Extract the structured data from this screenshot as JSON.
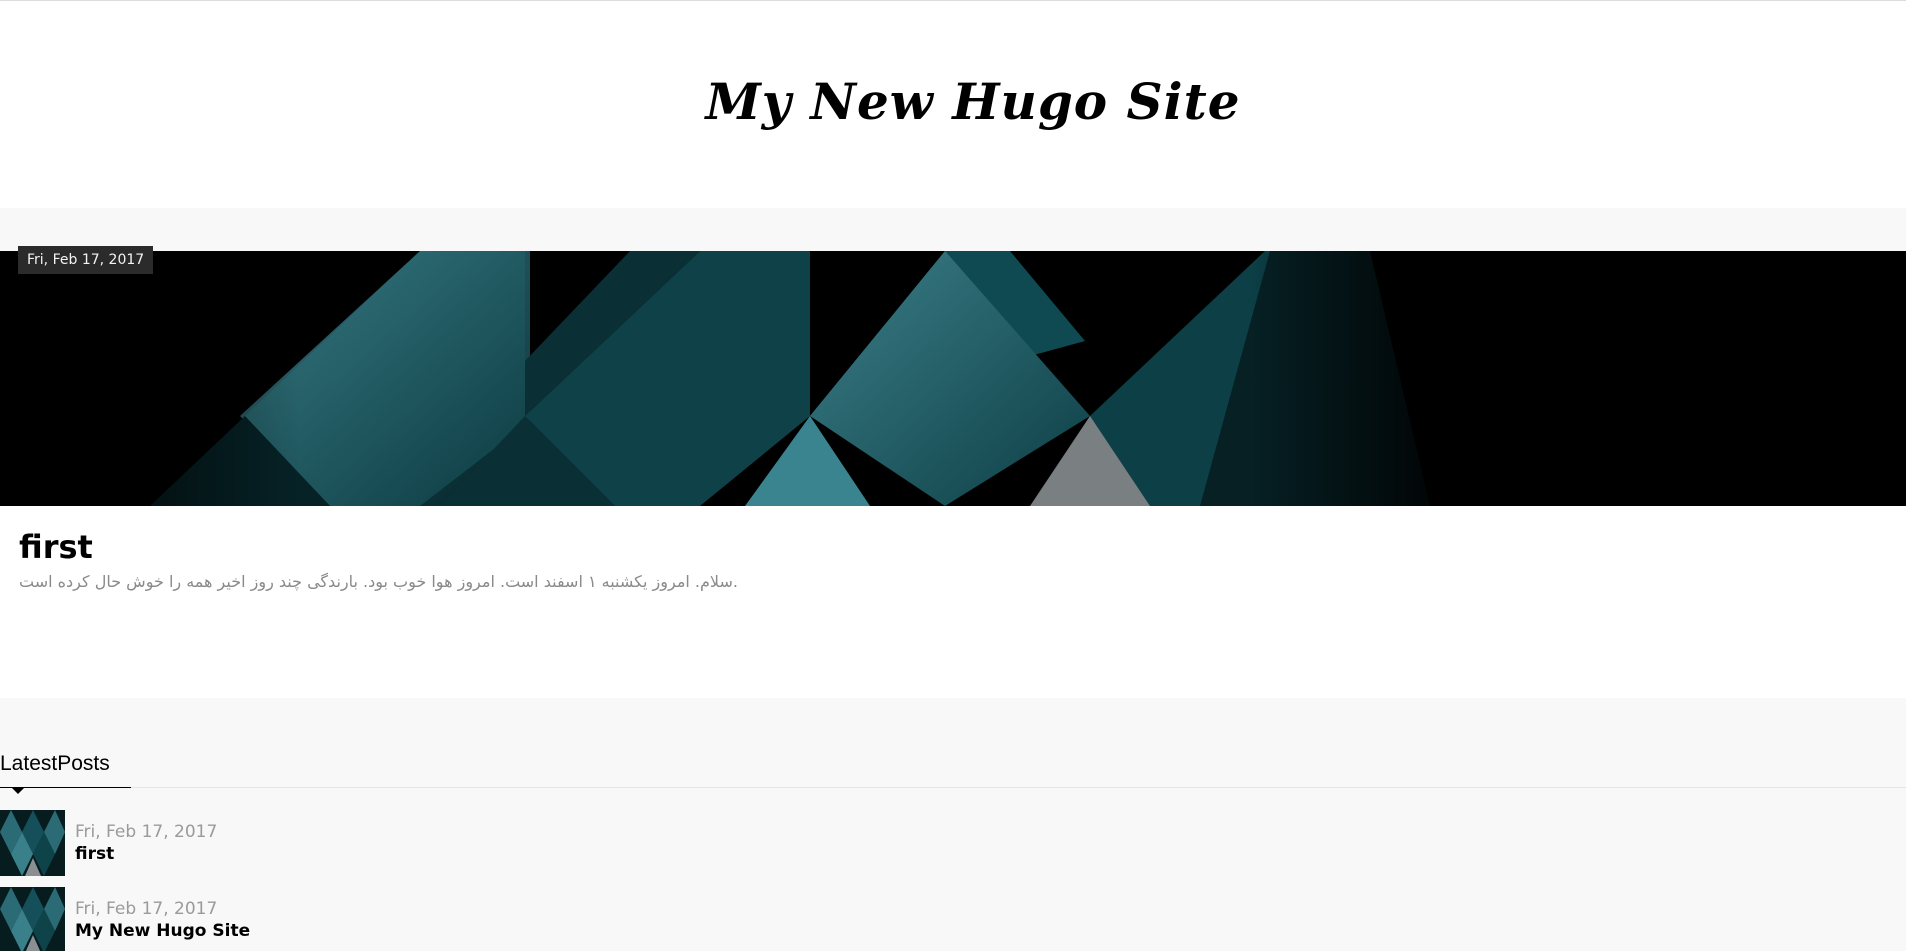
{
  "header": {
    "site_title": "My New Hugo Site"
  },
  "featured_post": {
    "date": "Fri, Feb 17, 2017",
    "title": "first",
    "excerpt": "سلام. امروز یکشنبه ۱ اسفند است. امروز هوا خوب بود. بارندگی چند روز اخیر همه را خوش حال کرده است."
  },
  "latest_posts": {
    "heading": "LatestPosts",
    "items": [
      {
        "date": "Fri, Feb 17, 2017",
        "title": "first"
      },
      {
        "date": "Fri, Feb 17, 2017",
        "title": "My New Hugo Site"
      }
    ]
  },
  "colors": {
    "teal_light": "#2f6e78",
    "teal_dark": "#0c3a40",
    "background": "#f8f8f8"
  }
}
